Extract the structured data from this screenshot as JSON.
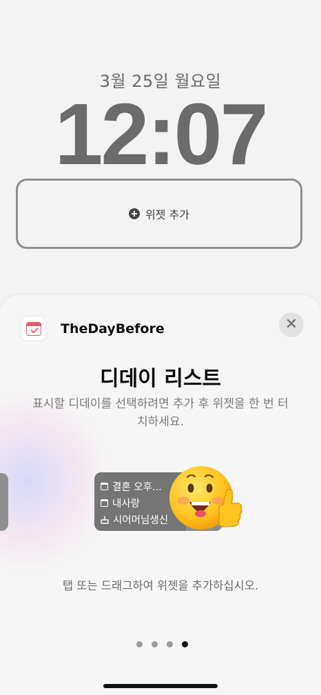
{
  "lock_screen": {
    "date": "3월 25일 월요일",
    "time": "12:07",
    "add_widget_label": "위젯 추가"
  },
  "sheet": {
    "app_name": "TheDayBefore",
    "widget_title": "디데이 리스트",
    "description": "표시할 디데이를 선택하려면 추가 후 위젯을 한 번 터치하세요.",
    "preview_items": [
      {
        "icon": "calendar-icon",
        "label": "결혼 오후..."
      },
      {
        "icon": "calendar-icon",
        "label": "내사랑"
      },
      {
        "icon": "cake-icon",
        "label": "시어머님생신"
      }
    ],
    "hint": "탭 또는 드래그하여 위젯을 추가하십시오.",
    "page_count": 4,
    "active_page": 4
  },
  "colors": {
    "accent_red": "#e45b6a",
    "time_gray": "#6b6b6b",
    "sheet_bg": "#f6f6f6"
  }
}
